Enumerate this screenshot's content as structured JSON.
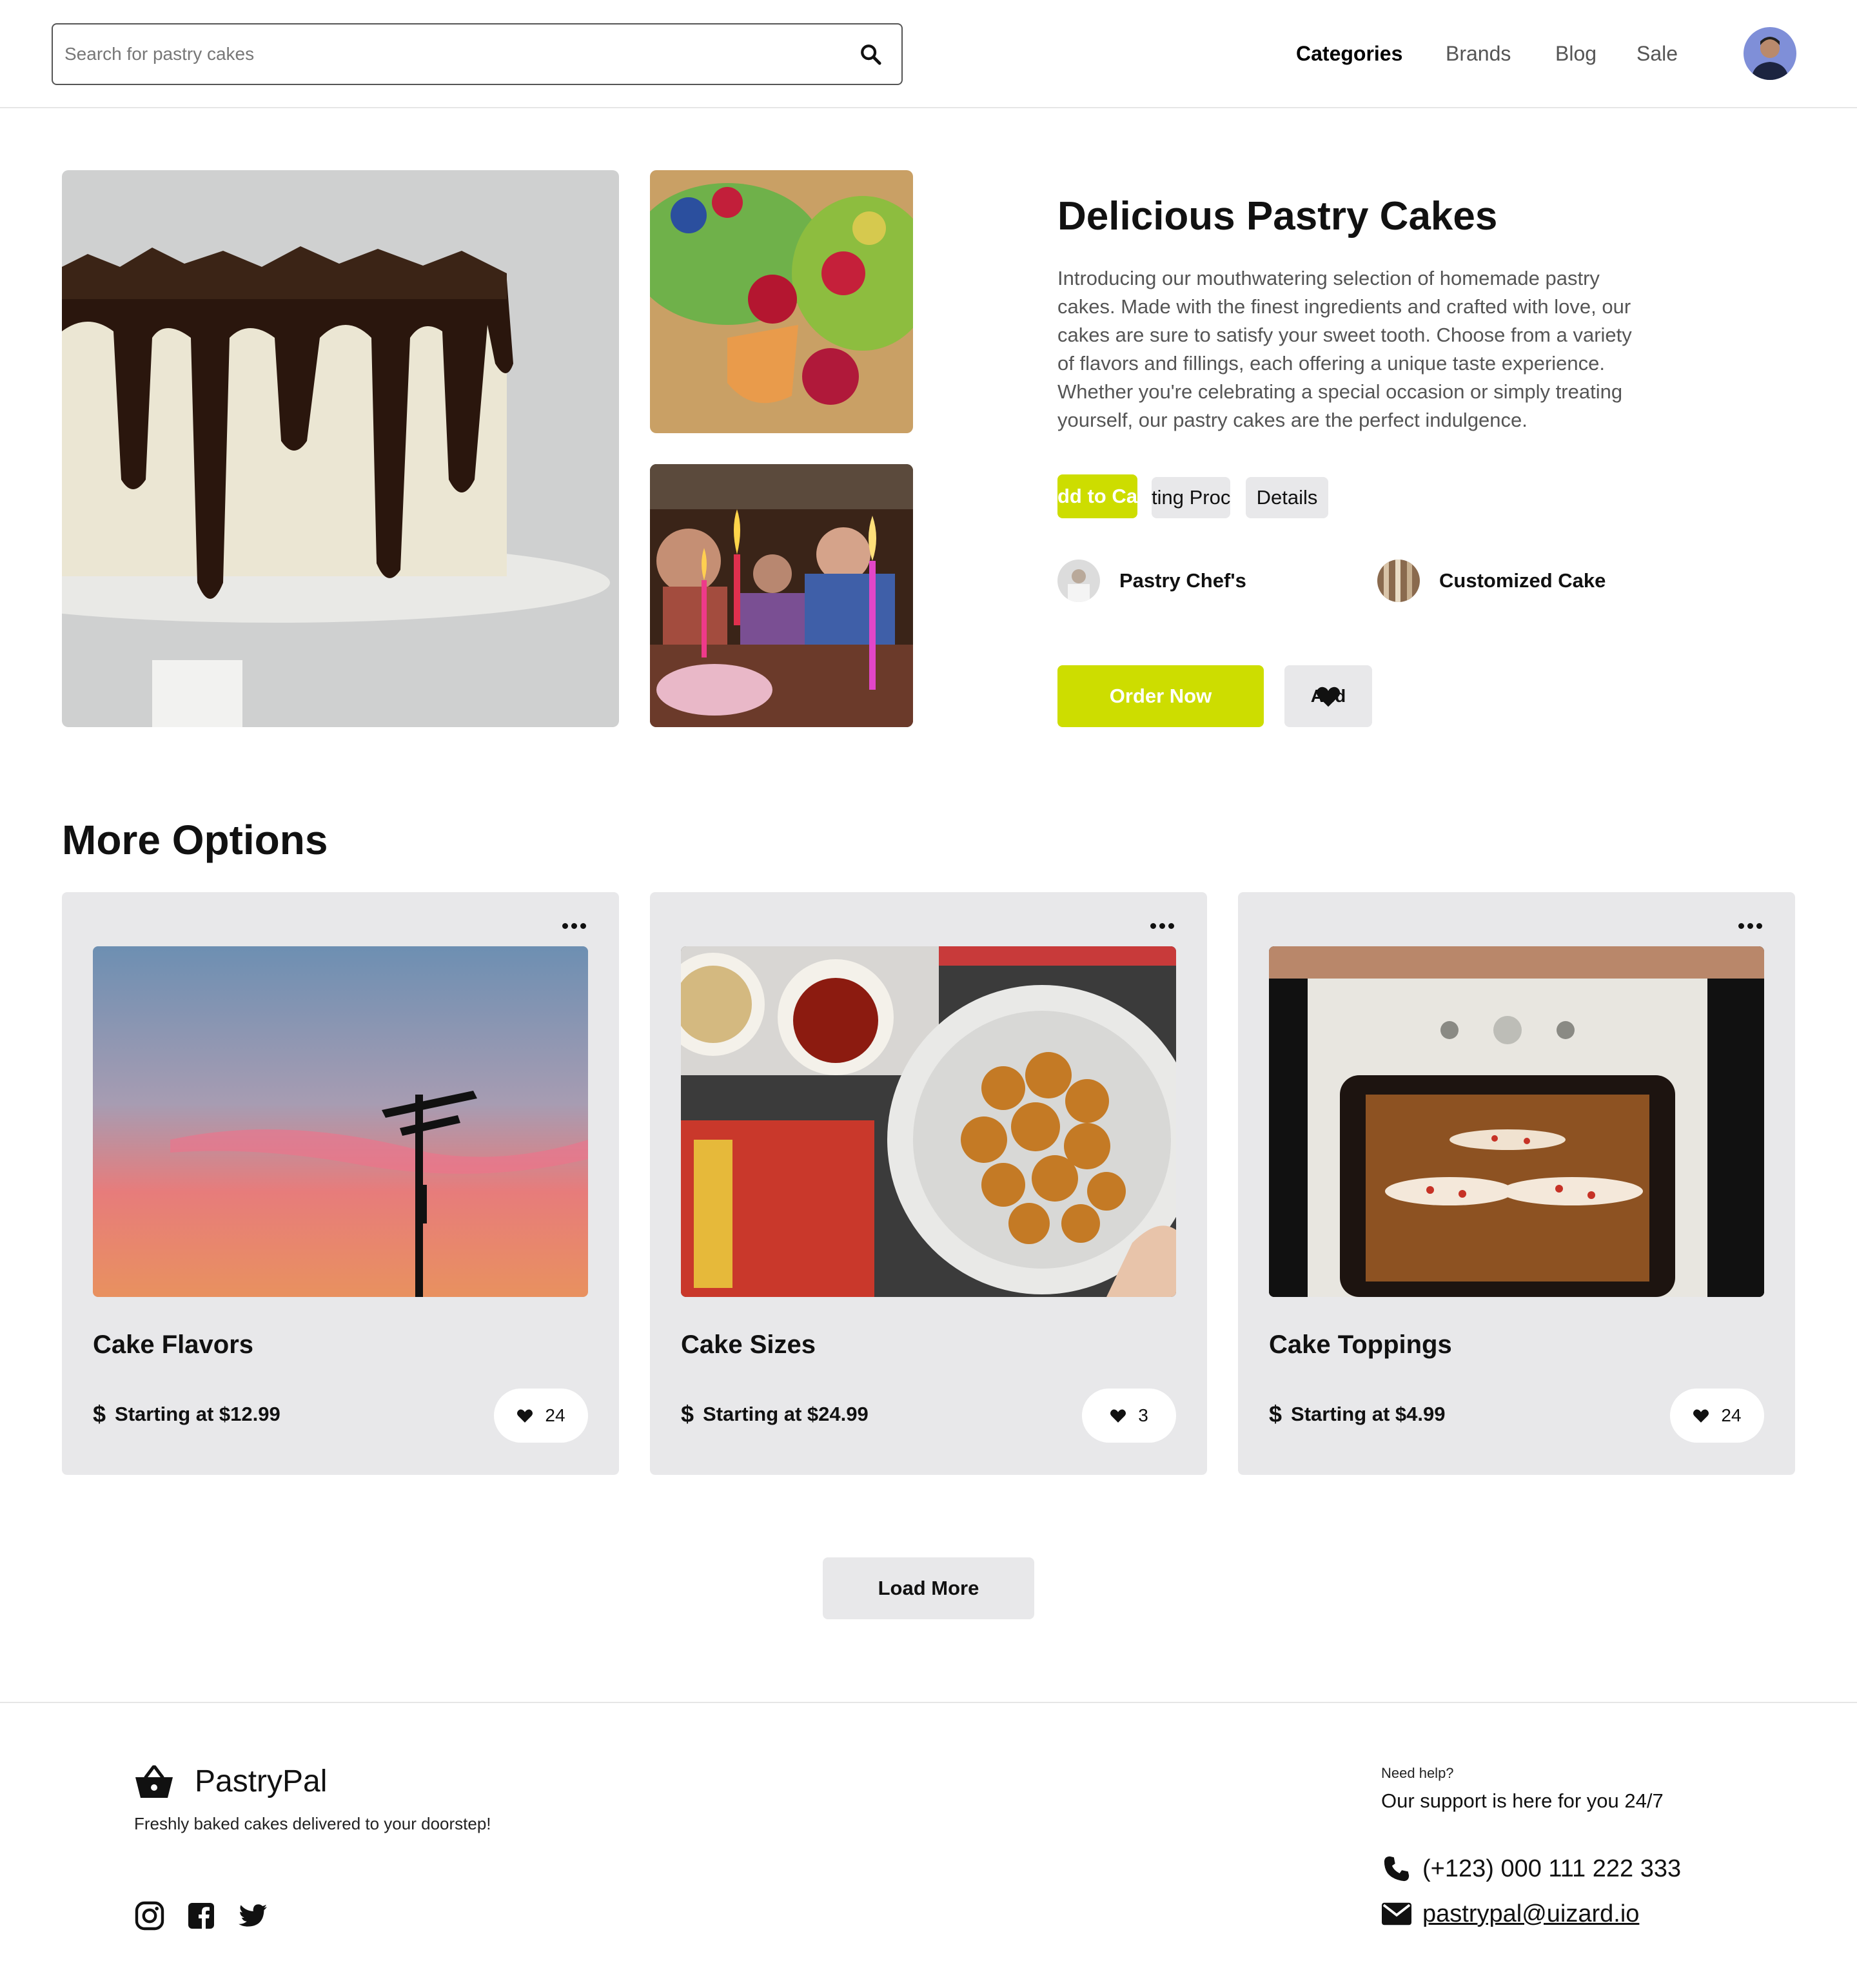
{
  "header": {
    "search": {
      "placeholder": "Search for pastry cakes",
      "value": ""
    },
    "nav": [
      {
        "label": "Categories",
        "active": true
      },
      {
        "label": "Brands",
        "active": false
      },
      {
        "label": "Blog",
        "active": false
      },
      {
        "label": "Sale",
        "active": false
      }
    ]
  },
  "hero": {
    "title": "Delicious Pastry Cakes",
    "description": "Introducing our mouthwatering selection of homemade pastry cakes. Made with the finest ingredients and crafted with love, our cakes are sure to satisfy your sweet tooth. Choose from a variety of flavors and fillings, each offering a unique taste experience. Whether you're celebrating a special occasion or simply treating yourself, our pastry cakes are the perfect indulgence.",
    "tabs": [
      {
        "label": "dd to Ca"
      },
      {
        "label": "ting Proc"
      },
      {
        "label": "Details"
      }
    ],
    "features": [
      {
        "label": "Pastry Chef's"
      },
      {
        "label": "Customized Cake"
      }
    ],
    "order_label": "Order Now",
    "add_label": "Add"
  },
  "more_options": {
    "title": "More Options",
    "cards": [
      {
        "title": "Cake Flavors",
        "price": "Starting at $12.99",
        "likes": "24"
      },
      {
        "title": "Cake Sizes",
        "price": "Starting at $24.99",
        "likes": "3"
      },
      {
        "title": "Cake Toppings",
        "price": "Starting at $4.99",
        "likes": "24"
      }
    ],
    "load_more_label": "Load More"
  },
  "footer": {
    "brand": "PastryPal",
    "tagline": "Freshly baked cakes delivered to your doorstep!",
    "help_small": "Need help?",
    "help_big": "Our support is here for you 24/7",
    "phone": "(+123) 000 111 222 333",
    "email": "pastrypal@uizard.io"
  },
  "colors": {
    "accent": "#cddd00",
    "chip_bg": "#e8e8ea"
  },
  "icons": [
    "search-icon",
    "avatar",
    "heart-icon",
    "more-icon",
    "dollar-icon",
    "basket-icon",
    "instagram-icon",
    "facebook-icon",
    "twitter-icon",
    "phone-icon",
    "mail-icon"
  ]
}
